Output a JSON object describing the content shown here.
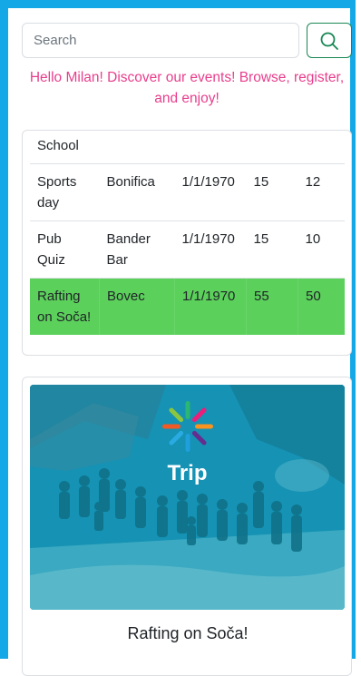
{
  "search": {
    "placeholder": "Search"
  },
  "greeting": "Hello Milan! Discover our events! Browse, register, and enjoy!",
  "events_table": {
    "rows": [
      {
        "name": "in School",
        "place": "",
        "date": "",
        "capacity": "",
        "registered": "",
        "partial": true
      },
      {
        "name": "Sports day",
        "place": "Bonifica",
        "date": "1/1/1970",
        "capacity": "15",
        "registered": "12"
      },
      {
        "name": "Pub Quiz",
        "place": "Bander Bar",
        "date": "1/1/1970",
        "capacity": "15",
        "registered": "10"
      },
      {
        "name": "Rafting on Soča!",
        "place": "Bovec",
        "date": "1/1/1970",
        "capacity": "55",
        "registered": "50",
        "highlighted": true
      }
    ],
    "highlight_color": "#5bd05b"
  },
  "event_card": {
    "image_label": "Trip",
    "title": "Rafting on Soča!"
  },
  "colors": {
    "frame": "#14a9e6",
    "greeting": "#e83e8c",
    "search_button_border": "#198754"
  }
}
